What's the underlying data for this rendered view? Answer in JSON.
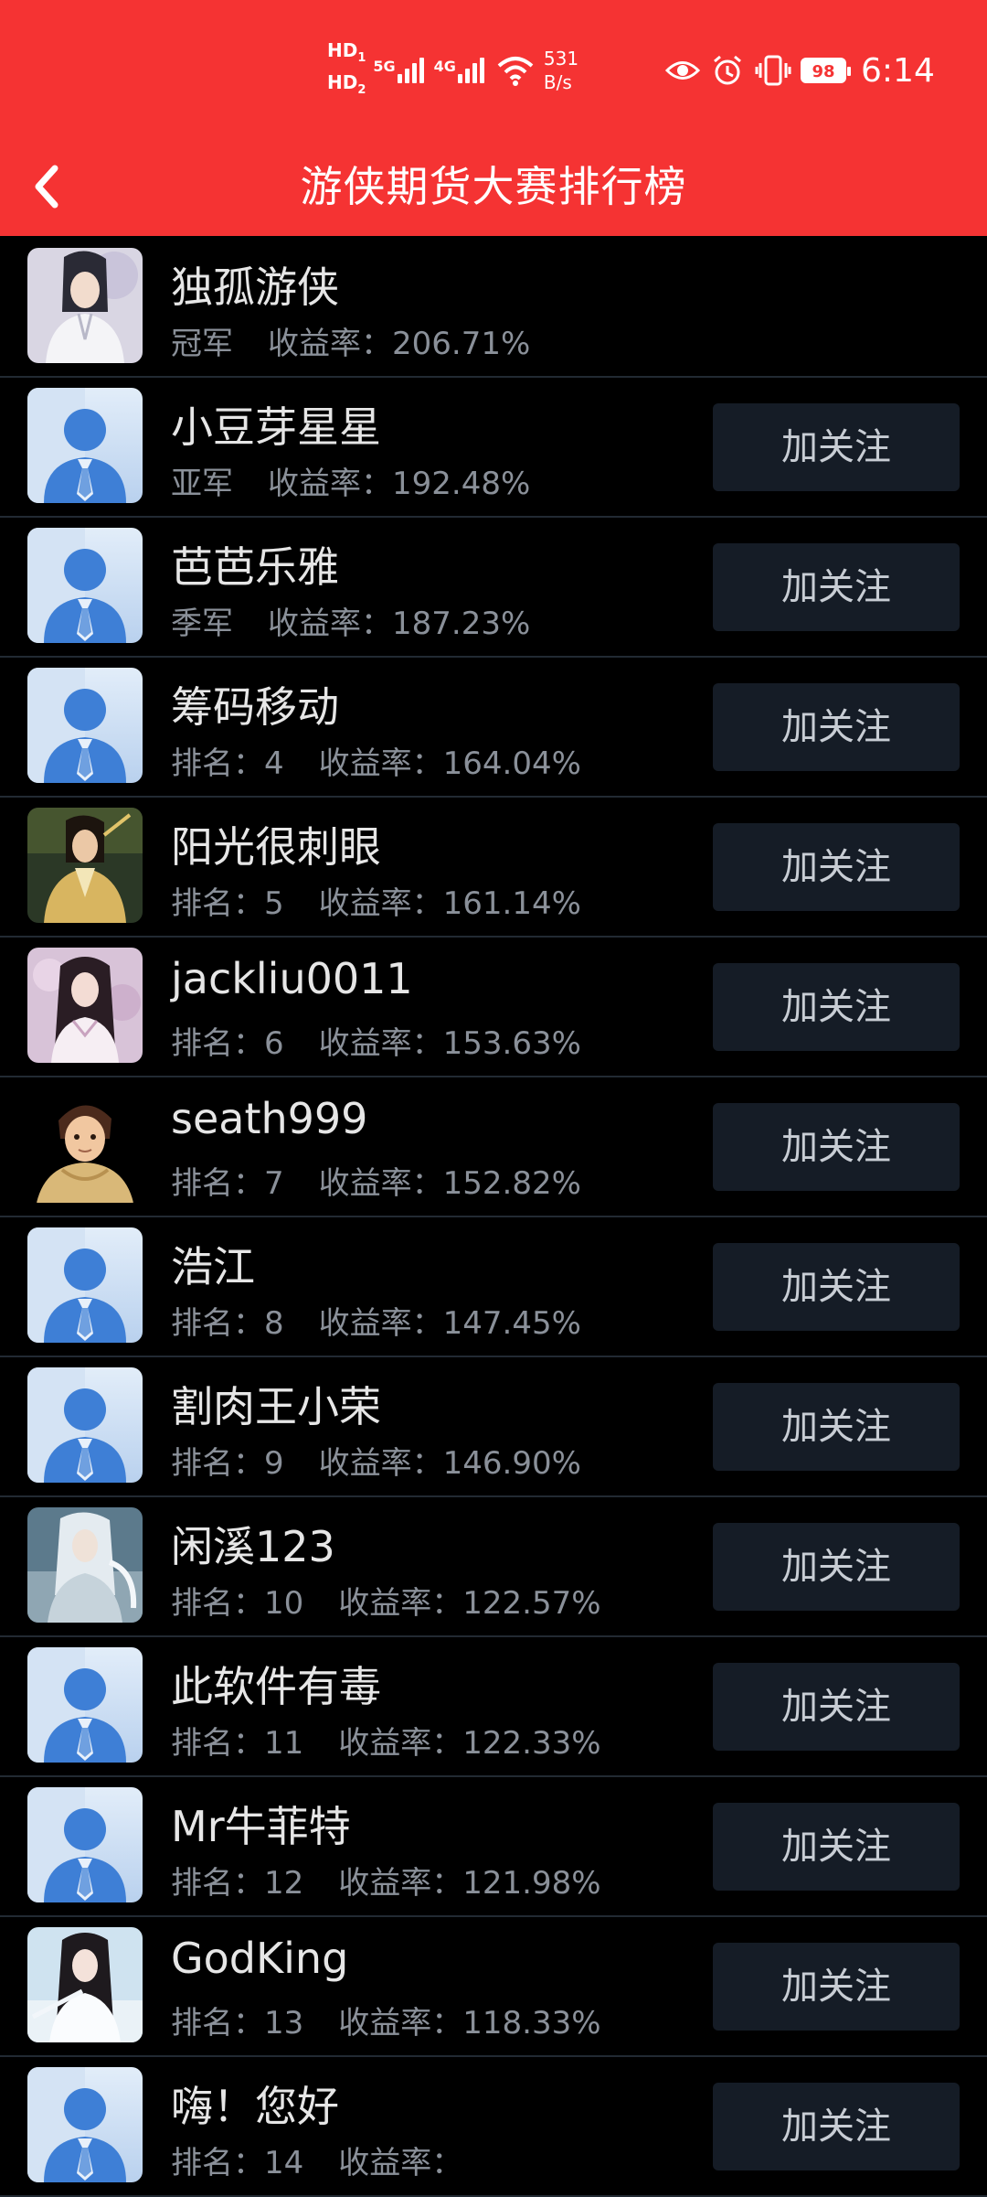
{
  "status_bar": {
    "hd1": "HD",
    "hd1_sub": "1",
    "hd2": "HD",
    "hd2_sub": "2",
    "net_5g": "5G",
    "net_4g": "4G",
    "speed_value": "531",
    "speed_unit": "B/s",
    "battery": "98",
    "time": "6:14"
  },
  "header": {
    "title": "游侠期货大赛排行榜"
  },
  "follow_label": "加关注",
  "ranking": [
    {
      "name": "独孤游侠",
      "rank_label": "冠军",
      "rate_label": "收益率：",
      "rate": "206.71%",
      "avatar": "hero-white-robe",
      "follow": false
    },
    {
      "name": "小豆芽星星",
      "rank_label": "亚军",
      "rate_label": "收益率：",
      "rate": "192.48%",
      "avatar": "default-user",
      "follow": true
    },
    {
      "name": "芭芭乐雅",
      "rank_label": "季军",
      "rate_label": "收益率：",
      "rate": "187.23%",
      "avatar": "default-user",
      "follow": true
    },
    {
      "name": "筹码移动",
      "rank_label": "排名：4",
      "rate_label": "收益率：",
      "rate": "164.04%",
      "avatar": "default-user",
      "follow": true
    },
    {
      "name": "阳光很刺眼",
      "rank_label": "排名：5",
      "rate_label": "收益率：",
      "rate": "161.14%",
      "avatar": "hero-gold-robe",
      "follow": true
    },
    {
      "name": "jackliu0011",
      "rank_label": "排名：6",
      "rate_label": "收益率：",
      "rate": "153.63%",
      "avatar": "lady-pink",
      "follow": true
    },
    {
      "name": "seath999",
      "rank_label": "排名：7",
      "rate_label": "收益率：",
      "rate": "152.82%",
      "avatar": "young-swordsman",
      "follow": true
    },
    {
      "name": "浩江",
      "rank_label": "排名：8",
      "rate_label": "收益率：",
      "rate": "147.45%",
      "avatar": "default-user",
      "follow": true
    },
    {
      "name": "割肉王小荣",
      "rank_label": "排名：9",
      "rate_label": "收益率：",
      "rate": "146.90%",
      "avatar": "default-user",
      "follow": true
    },
    {
      "name": "闲溪123",
      "rank_label": "排名：10",
      "rate_label": "收益率：",
      "rate": "122.57%",
      "avatar": "silver-hair-knight",
      "follow": true
    },
    {
      "name": "此软件有毒",
      "rank_label": "排名：11",
      "rate_label": "收益率：",
      "rate": "122.33%",
      "avatar": "default-user",
      "follow": true
    },
    {
      "name": "Mr牛菲特",
      "rank_label": "排名：12",
      "rate_label": "收益率：",
      "rate": "121.98%",
      "avatar": "default-user",
      "follow": true
    },
    {
      "name": "GodKing",
      "rank_label": "排名：13",
      "rate_label": "收益率：",
      "rate": "118.33%",
      "avatar": "lady-white",
      "follow": true
    },
    {
      "name": "嗨！您好",
      "rank_label": "排名：14",
      "rate_label": "收益率：",
      "rate": "",
      "avatar": "default-user",
      "follow": true
    }
  ],
  "colors": {
    "header_red": "#F53333",
    "background": "#000000",
    "follow_button": "#151C26",
    "divider": "#222A33",
    "meta_text": "#8A9099"
  }
}
